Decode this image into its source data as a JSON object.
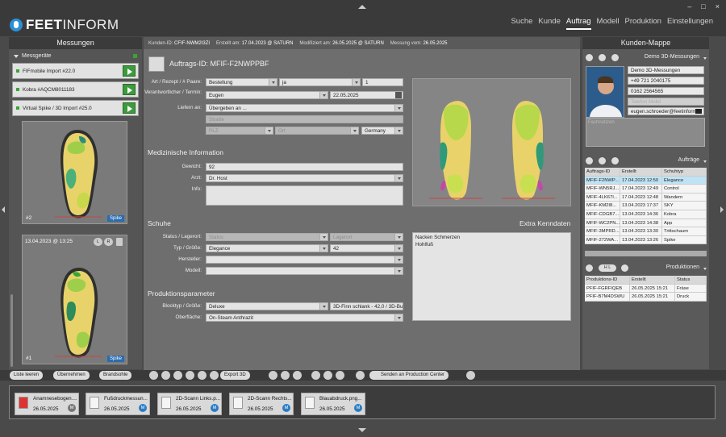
{
  "app": {
    "name_a": "FEET",
    "name_b": "INFORM"
  },
  "nav": [
    "Suche",
    "Kunde",
    "Auftrag",
    "Modell",
    "Produktion",
    "Einstellungen"
  ],
  "nav_active": 2,
  "window_controls": [
    "–",
    "□",
    "×"
  ],
  "left": {
    "title": "Messungen",
    "devices_header": "Messgeräte",
    "devices": [
      "FIFmobile Import #22.0",
      "Kobra #AQCM8011183",
      "Virtual Spike / 3D Import #25.0"
    ],
    "scans": [
      {
        "num": "#2",
        "badge": "Spike",
        "date": ""
      },
      {
        "num": "#1",
        "badge": "Spike",
        "date": "13.04.2023 @ 13:25"
      }
    ],
    "lr_labels": [
      "L",
      "R"
    ]
  },
  "info_bar": {
    "kunden_id_label": "Kunden-ID:",
    "kunden_id": "CFIF-NWM2I3ZI",
    "erstellt_label": "Erstellt am:",
    "erstellt": "17.04.2023 @ SATURN",
    "modifiziert_label": "Modifiziert am:",
    "modifiziert": "26.05.2025 @ SATURN",
    "messung_label": "Messung vom:",
    "messung": "26.05.2025"
  },
  "order": {
    "label": "Auftrags-ID:",
    "id": "MFIF-F2NWPPBF",
    "art_label": "Art / Rezept / # Paare:",
    "art": "Bestellung",
    "rezept": "ja",
    "paare": "1",
    "verantwortlicher_label": "Verantwortlicher / Termin:",
    "verantwortlicher": "Eugen",
    "termin": "22.05.2025",
    "liefern_label": "Liefern an:",
    "liefern": "Übergeben an ...",
    "strasse_ph": "Straße",
    "plz_ph": "PLZ",
    "ort_ph": "Ort",
    "land": "Germany"
  },
  "medical": {
    "title": "Medizinische Information",
    "gewicht_label": "Gewicht:",
    "gewicht": "92",
    "arzt_label": "Arzt:",
    "arzt": "Dr. Host",
    "info_label": "Info:"
  },
  "shoes": {
    "title": "Schuhe",
    "status_label": "Status / Lagerort:",
    "status_ph": "Status",
    "lagerort_ph": "Lagerort",
    "typ_label": "Typ / Größe:",
    "typ": "Elegance",
    "groesse": "42",
    "hersteller_label": "Hersteller:",
    "modell_label": "Modell:"
  },
  "extra": {
    "title": "Extra Kenndaten",
    "lines": [
      "Nacken Schmerzen",
      "Hohlfuß"
    ]
  },
  "production": {
    "title": "Produktionsparameter",
    "block_label": "Blocktyp / Größe:",
    "block": "Deluxe",
    "block_size": "3D-Finn schlank - 42,0 / 3D-Bu",
    "oberflaeche_label": "Oberfläche:",
    "oberflaeche": "On-Steam Anthrazit"
  },
  "toolbar": {
    "liste": "Liste leeren",
    "uebernehmen": "Übernehmen",
    "brandsohle": "Brandsohle",
    "export": "Export 3D",
    "senden": "Senden an Production Center"
  },
  "documents": [
    {
      "name": "Anamnesebogen....",
      "date": "26.05.2025",
      "mark": "M",
      "mark_color": "#777777"
    },
    {
      "name": "Fußdruckmessun...",
      "date": "26.05.2025",
      "mark": "M",
      "mark_color": "#2b7cc4"
    },
    {
      "name": "2D-Scann Links.p...",
      "date": "26.05.2025",
      "mark": "M",
      "mark_color": "#2b7cc4"
    },
    {
      "name": "2D-Scann Rechts...",
      "date": "26.05.2025",
      "mark": "M",
      "mark_color": "#2b7cc4"
    },
    {
      "name": "Blauabdruck.png...",
      "date": "26.05.2025",
      "mark": "M",
      "mark_color": "#2b7cc4"
    }
  ],
  "right": {
    "title": "Kunden-Mappe",
    "measure_select": "Demo 3D-Messungen",
    "contacts": [
      "Demo 3D-Messungen",
      "+49 721 2040175",
      "0162 2564565",
      "Telefon Mobil",
      "eugen.schroeder@feetinform..."
    ],
    "fachnotizen_ph": "Fachnotizen",
    "auftraege_title": "Aufträge",
    "auftraege_cols": [
      "Auftrags-ID",
      "Erstellt",
      "Schuhtyp"
    ],
    "auftraege": [
      [
        "MFIF-F2NWP...",
        "17.04.2023 12:50",
        "Elegance"
      ],
      [
        "MFIF-WN5RJ...",
        "17.04.2023 12:49",
        "Control"
      ],
      [
        "MFIF-4LK67I...",
        "17.04.2023 12:48",
        "Wandern"
      ],
      [
        "MFIF-KM2I8...",
        "13.04.2023 17:37",
        "SKY"
      ],
      [
        "MFIF-CDGB7...",
        "13.04.2023 14:36",
        "Kobra"
      ],
      [
        "MFIF-WC2PN...",
        "13.04.2023 14:38",
        "App"
      ],
      [
        "MFIF-3MPRD...",
        "13.04.2023 13:30",
        "Trittschaum"
      ],
      [
        "MFIF-272WA...",
        "13.04.2023 13:26",
        "Spike"
      ]
    ],
    "produktionen_title": "Produktionen",
    "hl_label": "H L",
    "produktionen_cols": [
      "Produktions-ID",
      "Erstellt",
      "Status"
    ],
    "produktionen": [
      [
        "PFIF-FGRFIQEB",
        "26.05.2025 15:21",
        "Fräse"
      ],
      [
        "PFIF-B7M4DSWU",
        "26.05.2025 15:21",
        "Druck"
      ]
    ]
  }
}
